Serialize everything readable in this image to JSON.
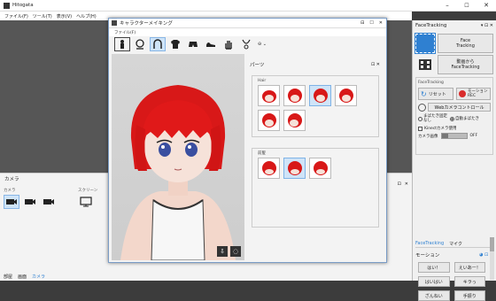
{
  "app": {
    "title": "Hitogata"
  },
  "menu": {
    "file": "ファイル(F)",
    "tools": "ツール(T)",
    "view": "表示(V)",
    "help": "ヘルプ(H)"
  },
  "camera_panel": {
    "title": "カメラ",
    "camera_group": "カメラ",
    "screen_group": "スクリーン",
    "tabs": [
      "部屋",
      "画面",
      "カメラ"
    ]
  },
  "dialog": {
    "title": "キャラクターメイキング",
    "file_menu": "ファイル(F)",
    "parts_title": "パーツ",
    "hair_label": "Hair",
    "bangs_label": "前髪"
  },
  "face_tracking": {
    "title": "FaceTracking",
    "face_tracking_button": "Face\nTracking",
    "video_tracking_button": "動画から\nFaceTracking",
    "section_label": "FaceTracking",
    "reset_label": "リセット",
    "motion_rec_label": "モーション\nREC",
    "webcam_control_label": "Webカメラコントロール",
    "blink_off_label": "まばたき固定\nなし",
    "blink_auto_label": "自動まばたき",
    "kinect_label": "Kinectカメラ使用",
    "camera_image_label": "カメラ画像",
    "camera_image_state": "OFF",
    "tabs": [
      "FaceTracking",
      "マイク"
    ]
  },
  "motion": {
    "title": "モーション",
    "buttons": [
      "はい！",
      "えいあー！",
      "はいはい",
      "キラっ",
      "ざんねい",
      "手振り"
    ]
  },
  "colors": {
    "accent": "#2f80d1",
    "rec": "#d92b2b",
    "selected": "#cfe4f8",
    "hair": "#d81818"
  }
}
